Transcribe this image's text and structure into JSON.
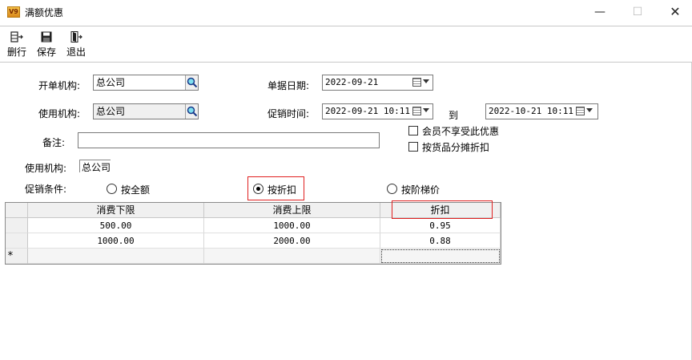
{
  "window": {
    "title": "满额优惠",
    "app_icon_text": "V9"
  },
  "toolbar": {
    "delete_row": "删行",
    "save": "保存",
    "exit": "退出"
  },
  "form": {
    "issuing_org_label": "开单机构:",
    "issuing_org_value": "总公司",
    "using_org_label": "使用机构:",
    "using_org_value": "总公司",
    "doc_date_label": "单据日期:",
    "doc_date_value": "2022-09-21",
    "promo_time_label": "促销时间:",
    "promo_start": "2022-09-21 10:11",
    "to_label": "到",
    "promo_end": "2022-10-21 10:11",
    "note_label": "备注:",
    "note_value": "",
    "member_excluded_label": "会员不享受此优惠",
    "member_excluded_checked": false,
    "split_discount_label": "按货品分摊折扣",
    "split_discount_checked": false,
    "using_org2_label": "使用机构:",
    "using_org2_value": "总公司",
    "condition_label": "促销条件:",
    "radio_amount": "按全额",
    "radio_discount": "按折扣",
    "radio_tier": "按阶梯价",
    "selected_condition": "按折扣"
  },
  "grid": {
    "columns": [
      "消费下限",
      "消费上限",
      "折扣"
    ],
    "rows": [
      [
        "500.00",
        "1000.00",
        "0.95"
      ],
      [
        "1000.00",
        "2000.00",
        "0.88"
      ]
    ],
    "new_row_marker": "*"
  },
  "colors": {
    "highlight_border": "#e02020",
    "grid_header_bg": "#f0f0f0"
  }
}
